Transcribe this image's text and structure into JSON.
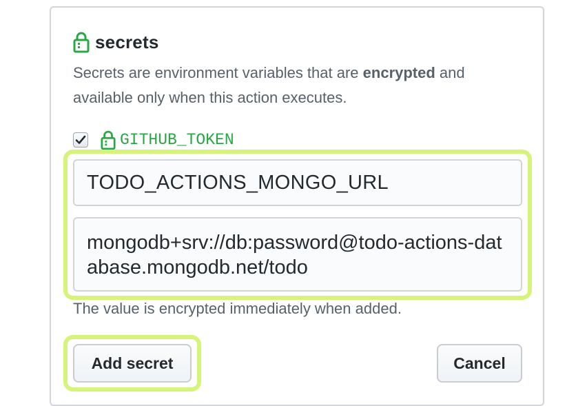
{
  "section": {
    "title": "secrets",
    "description_prefix": "Secrets are environment variables that are ",
    "description_emphasis": "encrypted",
    "description_suffix": " and available only when this action executes.",
    "lock_icon": "lock-icon",
    "accent_color": "#28a745"
  },
  "token": {
    "checked": true,
    "name": "GITHUB_TOKEN",
    "icon": "lock-icon",
    "color": "#28a745"
  },
  "form": {
    "name_value": "TODO_ACTIONS_MONGO_URL",
    "value_value": "mongodb+srv://db:password@todo-actions-database.mongodb.net/todo",
    "hint": "The value is encrypted immediately when added.",
    "highlight_color": "#d6f47a"
  },
  "actions": {
    "add_label": "Add secret",
    "cancel_label": "Cancel"
  }
}
